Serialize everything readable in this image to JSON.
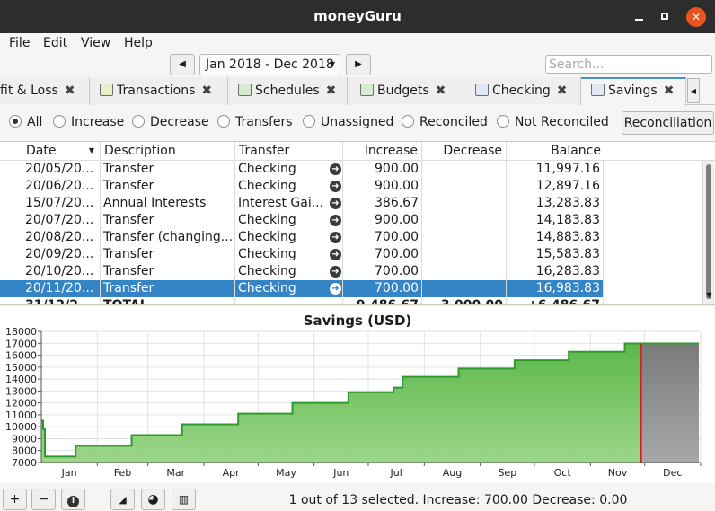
{
  "window": {
    "title": "moneyGuru"
  },
  "menu": [
    "File",
    "Edit",
    "View",
    "Help"
  ],
  "date_range": "Jan 2018 - Dec 2018",
  "search": {
    "placeholder": "Search..."
  },
  "tabs": [
    {
      "label": "fit & Loss"
    },
    {
      "label": "Transactions"
    },
    {
      "label": "Schedules"
    },
    {
      "label": "Budgets"
    },
    {
      "label": "Checking"
    },
    {
      "label": "Savings",
      "active": true
    }
  ],
  "filters": {
    "options": [
      "All",
      "Increase",
      "Decrease",
      "Transfers",
      "Unassigned",
      "Reconciled",
      "Not Reconciled"
    ],
    "selected": "All",
    "reconciliation_label": "Reconciliation"
  },
  "table": {
    "columns": [
      "Date",
      "Description",
      "Transfer",
      "Increase",
      "Decrease",
      "Balance"
    ],
    "rows": [
      {
        "date": "20/05/20...",
        "description": "Transfer",
        "transfer": "Checking",
        "increase": "900.00",
        "decrease": "",
        "balance": "11,997.16"
      },
      {
        "date": "20/06/20...",
        "description": "Transfer",
        "transfer": "Checking",
        "increase": "900.00",
        "decrease": "",
        "balance": "12,897.16"
      },
      {
        "date": "15/07/20...",
        "description": "Annual Interests",
        "transfer": "Interest Gai...",
        "increase": "386.67",
        "decrease": "",
        "balance": "13,283.83"
      },
      {
        "date": "20/07/20...",
        "description": "Transfer",
        "transfer": "Checking",
        "increase": "900.00",
        "decrease": "",
        "balance": "14,183.83"
      },
      {
        "date": "20/08/20...",
        "description": "Transfer (changing...",
        "transfer": "Checking",
        "increase": "700.00",
        "decrease": "",
        "balance": "14,883.83"
      },
      {
        "date": "20/09/20...",
        "description": "Transfer",
        "transfer": "Checking",
        "increase": "700.00",
        "decrease": "",
        "balance": "15,583.83"
      },
      {
        "date": "20/10/20...",
        "description": "Transfer",
        "transfer": "Checking",
        "increase": "700.00",
        "decrease": "",
        "balance": "16,283.83"
      },
      {
        "date": "20/11/20...",
        "description": "Transfer",
        "transfer": "Checking",
        "increase": "700.00",
        "decrease": "",
        "balance": "16,983.83",
        "selected": true
      }
    ],
    "total_row": {
      "date": "31/12/2...",
      "description": "TOTAL",
      "transfer": "",
      "increase": "9,486.67",
      "decrease": "3,000.00",
      "balance": "+6,486.67"
    }
  },
  "chart_data": {
    "type": "area",
    "title": "Savings (USD)",
    "xlabel": "",
    "ylabel": "",
    "x_ticks": [
      "Jan",
      "Feb",
      "Mar",
      "Apr",
      "May",
      "Jun",
      "Jul",
      "Aug",
      "Sep",
      "Oct",
      "Nov",
      "Dec"
    ],
    "y_ticks": [
      7000,
      8000,
      9000,
      10000,
      11000,
      12000,
      13000,
      14000,
      15000,
      16000,
      17000,
      18000
    ],
    "ylim": [
      7000,
      18000
    ],
    "grid": true,
    "series": [
      {
        "points": [
          [
            "2018-01-01",
            10500
          ],
          [
            "2018-01-02",
            9800
          ],
          [
            "2018-01-03",
            7500
          ],
          [
            "2018-01-20",
            8400
          ],
          [
            "2018-02-20",
            9300
          ],
          [
            "2018-03-20",
            10200
          ],
          [
            "2018-04-20",
            11100
          ],
          [
            "2018-05-20",
            11997.16
          ],
          [
            "2018-06-20",
            12897.16
          ],
          [
            "2018-07-15",
            13283.83
          ],
          [
            "2018-07-20",
            14183.83
          ],
          [
            "2018-08-20",
            14883.83
          ],
          [
            "2018-09-20",
            15583.83
          ],
          [
            "2018-10-20",
            16283.83
          ],
          [
            "2018-11-20",
            16983.83
          ],
          [
            "2018-12-31",
            16983.83
          ]
        ]
      }
    ],
    "today_marker": "2018-11-29",
    "colors": {
      "fill_top": "#9dd68a",
      "fill_bottom": "#5cb84a",
      "line": "#2e9a2e",
      "future": "#8c8c8c",
      "marker": "#d62020"
    }
  },
  "bottom_bar": {
    "buttons": [
      "+",
      "−"
    ],
    "status": "1 out of 13 selected. Increase: 700.00 Decrease: 0.00"
  }
}
